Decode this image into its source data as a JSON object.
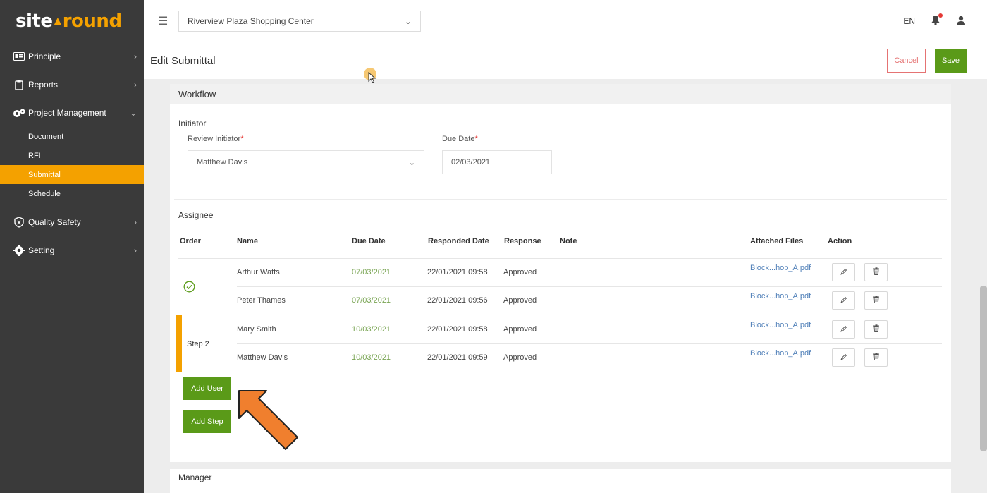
{
  "brand": {
    "part1": "site",
    "part2": "round"
  },
  "sidebar": {
    "items": [
      {
        "label": "Principle"
      },
      {
        "label": "Reports"
      },
      {
        "label": "Project Management"
      },
      {
        "label": "Quality Safety"
      },
      {
        "label": "Setting"
      }
    ],
    "sub_items": [
      {
        "label": "Document"
      },
      {
        "label": "RFI"
      },
      {
        "label": "Submittal"
      },
      {
        "label": "Schedule"
      }
    ],
    "active_sub": "Submittal"
  },
  "topbar": {
    "project": "Riverview Plaza Shopping Center",
    "language": "EN"
  },
  "page": {
    "title": "Edit Submittal",
    "cancel_label": "Cancel",
    "save_label": "Save"
  },
  "workflow": {
    "header": "Workflow",
    "initiator": {
      "section_label": "Initiator",
      "review_initiator_label": "Review Initiator",
      "review_initiator_value": "Matthew Davis",
      "due_date_label": "Due Date",
      "due_date_value": "02/03/2021",
      "required_mark": "*"
    },
    "assignee": {
      "section_label": "Assignee",
      "columns": [
        "Order",
        "Name",
        "Due Date",
        "Responded Date",
        "Response",
        "Note",
        "Attached Files",
        "Action"
      ],
      "rows": [
        {
          "name": "Arthur Watts",
          "due": "07/03/2021",
          "responded": "22/01/2021 09:58",
          "response": "Approved",
          "note": "",
          "file": "Block...hop_A.pdf"
        },
        {
          "name": "Peter Thames",
          "due": "07/03/2021",
          "responded": "22/01/2021 09:56",
          "response": "Approved",
          "note": "",
          "file": "Block...hop_A.pdf"
        },
        {
          "name": "Mary Smith",
          "due": "10/03/2021",
          "responded": "22/01/2021 09:58",
          "response": "Approved",
          "note": "",
          "file": "Block...hop_A.pdf"
        },
        {
          "name": "Matthew Davis",
          "due": "10/03/2021",
          "responded": "22/01/2021 09:59",
          "response": "Approved",
          "note": "",
          "file": "Block...hop_A.pdf"
        }
      ],
      "step2_label": "Step 2",
      "add_user_label": "Add User",
      "add_step_label": "Add Step"
    },
    "manager": {
      "section_label": "Manager"
    }
  },
  "colors": {
    "accent": "#f4a100",
    "primary_green": "#5a9a18",
    "sidebar_bg": "#3a3a3a",
    "annotation_arrow": "#f07f2e"
  }
}
